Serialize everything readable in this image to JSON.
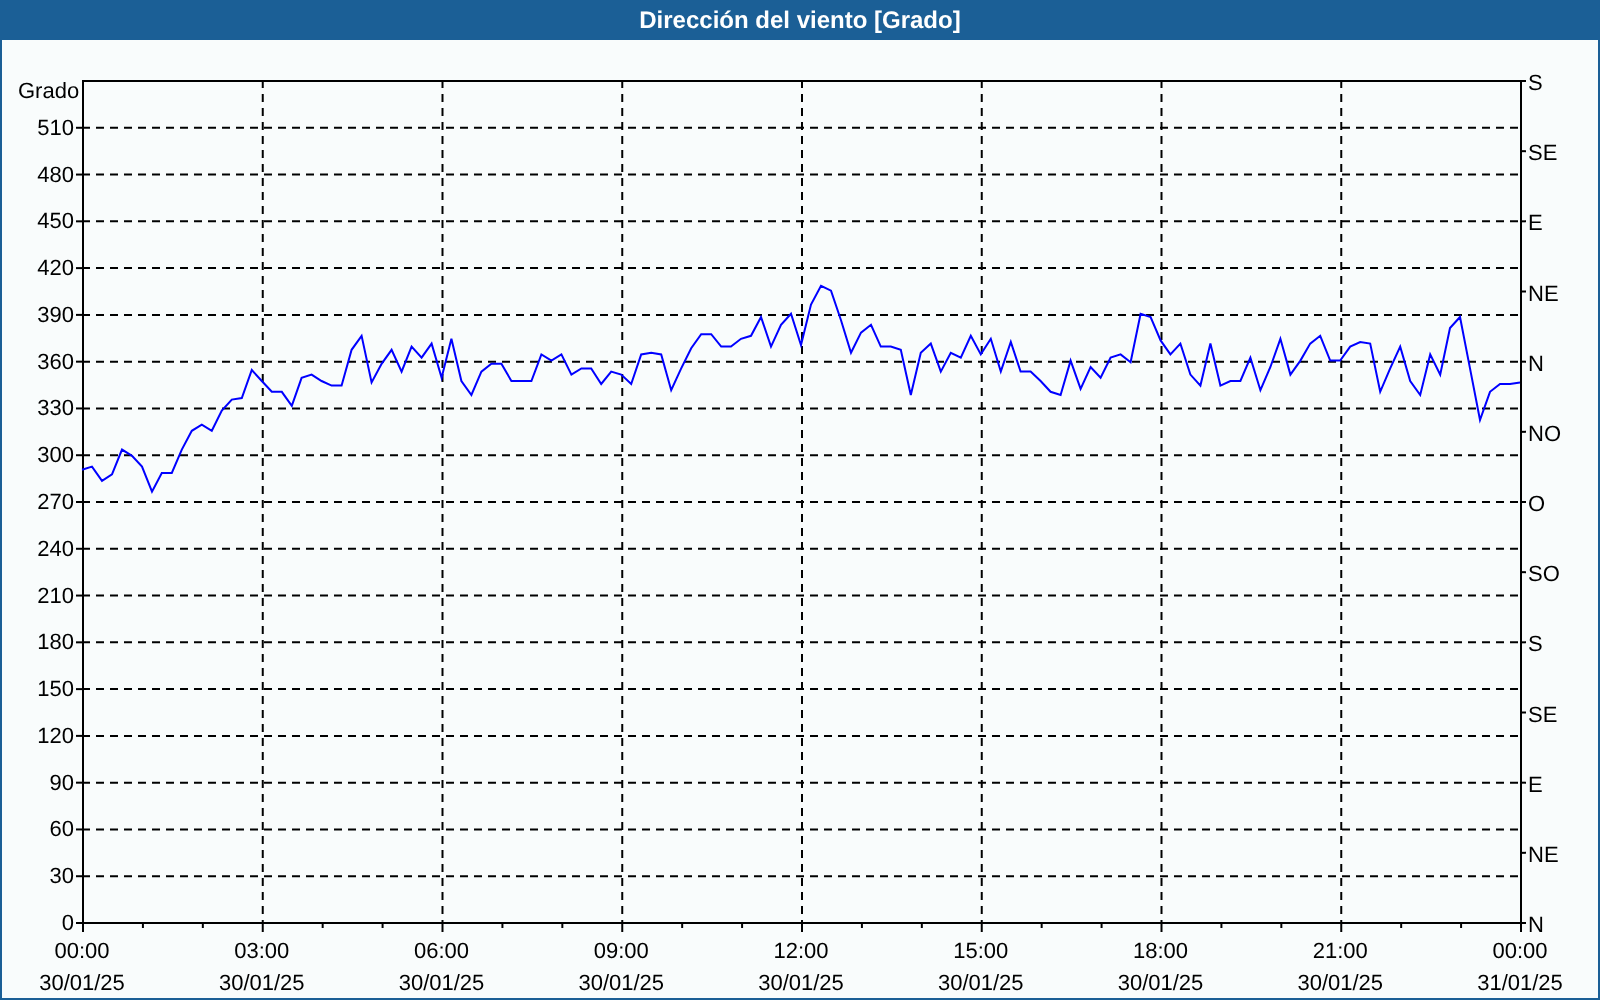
{
  "window": {
    "title": "Dirección del viento [Grado]"
  },
  "chart": {
    "chart_data": {
      "type": "line",
      "grid": true,
      "ylabel": "Grado",
      "ylim": [
        0,
        540
      ],
      "yticks": [
        0,
        30,
        60,
        90,
        120,
        150,
        180,
        210,
        240,
        270,
        300,
        330,
        360,
        390,
        420,
        450,
        480,
        510
      ],
      "categories": [
        "00:00 30/01/25",
        null,
        null,
        null,
        null,
        null,
        null,
        null,
        null,
        null,
        null,
        null,
        null,
        null,
        null,
        null,
        null,
        null,
        "03:00 30/01/25",
        null,
        null,
        null,
        null,
        null,
        null,
        null,
        null,
        null,
        null,
        null,
        null,
        null,
        null,
        null,
        null,
        null,
        "06:00 30/01/25",
        null,
        null,
        null,
        null,
        null,
        null,
        null,
        null,
        null,
        null,
        null,
        null,
        null,
        null,
        null,
        null,
        null,
        "09:00 30/01/25",
        null,
        null,
        null,
        null,
        null,
        null,
        null,
        null,
        null,
        null,
        null,
        null,
        null,
        null,
        null,
        null,
        null,
        "12:00 30/01/25",
        null,
        null,
        null,
        null,
        null,
        null,
        null,
        null,
        null,
        null,
        null,
        null,
        null,
        null,
        null,
        null,
        null,
        "15:00 30/01/25",
        null,
        null,
        null,
        null,
        null,
        null,
        null,
        null,
        null,
        null,
        null,
        null,
        null,
        null,
        null,
        null,
        null,
        "18:00 30/01/25",
        null,
        null,
        null,
        null,
        null,
        null,
        null,
        null,
        null,
        null,
        null,
        null,
        null,
        null,
        null,
        null,
        null,
        "21:00 30/01/25",
        null,
        null,
        null,
        null,
        null,
        null,
        null,
        null,
        null,
        null,
        null,
        null,
        null,
        null,
        null,
        null,
        null,
        "00:00 31/01/25"
      ],
      "series": [
        {
          "color": "#0000ff",
          "values": [
            290,
            292,
            283,
            287,
            303,
            299,
            292,
            276,
            288,
            288,
            303,
            315,
            319,
            315,
            328,
            335,
            336,
            354,
            347,
            340,
            340,
            331,
            349,
            351,
            347,
            344,
            344,
            367,
            376,
            346,
            358,
            367,
            353,
            369,
            362,
            371,
            349,
            374,
            347,
            338,
            353,
            358,
            358,
            347,
            347,
            347,
            364,
            360,
            364,
            351,
            355,
            355,
            345,
            353,
            351,
            345,
            364,
            365,
            364,
            341,
            355,
            368,
            377,
            377,
            369,
            369,
            374,
            376,
            388,
            369,
            383,
            390,
            370,
            396,
            408,
            405,
            386,
            365,
            378,
            383,
            369,
            369,
            367,
            338,
            365,
            371,
            353,
            365,
            362,
            376,
            364,
            374,
            353,
            372,
            353,
            353,
            347,
            340,
            338,
            360,
            342,
            356,
            349,
            362,
            364,
            359,
            390,
            388,
            373,
            364,
            371,
            351,
            344,
            371,
            344,
            347,
            347,
            362,
            341,
            356,
            374,
            351,
            360,
            371,
            376,
            360,
            360,
            369,
            372,
            371,
            340,
            355,
            369,
            347,
            338,
            364,
            351,
            381,
            388,
            355,
            322,
            340,
            345,
            345,
            346
          ]
        }
      ]
    },
    "compass_axis": {
      "labels": [
        "S",
        "SE",
        "E",
        "NE",
        "N",
        "NO",
        "O",
        "SO",
        "S",
        "SE",
        "E",
        "NE",
        "N"
      ]
    }
  }
}
